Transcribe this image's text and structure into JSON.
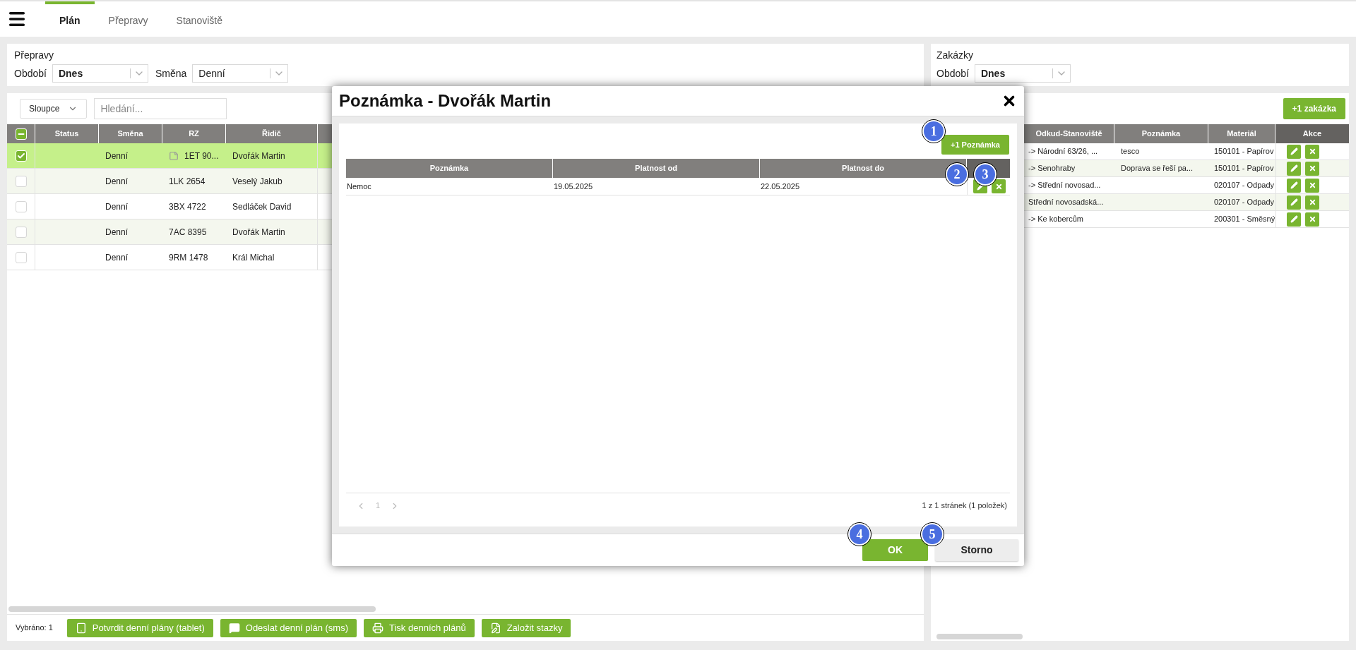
{
  "tabs": [
    {
      "label": "Plán",
      "selected": true
    },
    {
      "label": "Přepravy",
      "selected": false
    },
    {
      "label": "Stanoviště",
      "selected": false
    }
  ],
  "left_panel": {
    "title": "Přepravy",
    "filters": [
      {
        "label": "Období",
        "value": "Dnes",
        "emphasized": true
      },
      {
        "label": "Směna",
        "value": "Denní",
        "emphasized": false
      }
    ],
    "columns_button": "Sloupce",
    "search_placeholder": "Hledání...",
    "table": {
      "select_all_partial": true,
      "columns": [
        "Status",
        "Směna",
        "RZ",
        "Řidič"
      ],
      "rows": [
        {
          "selected": true,
          "has_note": true,
          "cells": [
            "",
            "Denní",
            "1ET 90...",
            "Dvořák Martin"
          ]
        },
        {
          "selected": false,
          "has_note": false,
          "cells": [
            "",
            "Denní",
            "1LK 2654",
            "Veselý Jakub"
          ]
        },
        {
          "selected": false,
          "has_note": false,
          "cells": [
            "",
            "Denní",
            "3BX 4722",
            "Sedláček David"
          ]
        },
        {
          "selected": false,
          "has_note": false,
          "cells": [
            "",
            "Denní",
            "7AC 8395",
            "Dvořák Martin"
          ]
        },
        {
          "selected": false,
          "has_note": false,
          "cells": [
            "",
            "Denní",
            "9RM 1478",
            "Král Michal"
          ]
        }
      ]
    },
    "selected_count": "Vybráno: 1",
    "actions": [
      {
        "label": "Potvrdit denní plány (tablet)",
        "kind": "tablet"
      },
      {
        "label": "Odeslat denní plán (sms)",
        "kind": "sms"
      },
      {
        "label": "Tisk denních plánů",
        "kind": "print"
      },
      {
        "label": "Založit stazky",
        "kind": "edit"
      }
    ]
  },
  "right_panel": {
    "title": "Zakázky",
    "filters": [
      {
        "label": "Období",
        "value": "Dnes",
        "emphasized": true
      }
    ],
    "add_button": "+1 zakázka",
    "table": {
      "columns": [
        {
          "label": "Odkud-Stanoviště",
          "kind": "data"
        },
        {
          "label": "Poznámka",
          "kind": "data"
        },
        {
          "label": "Materiál",
          "kind": "data"
        },
        {
          "label": "Akce",
          "kind": "actions"
        }
      ],
      "rows": [
        {
          "cells": [
            "-> Národní 63/26, ...",
            "tesco",
            "150101 - Papírov"
          ]
        },
        {
          "cells": [
            "-> Senohraby",
            "Doprava se řeší pa...",
            "150101 - Papírov"
          ]
        },
        {
          "cells": [
            "-> Střední novosad...",
            "",
            "020107 - Odpady"
          ]
        },
        {
          "cells": [
            "Střední novosadská...",
            "",
            "020107 - Odpady"
          ]
        },
        {
          "cells": [
            "-> Ke kobercům",
            "",
            "200301 - Směsný"
          ]
        }
      ]
    }
  },
  "modal": {
    "title": "Poznámka - Dvořák Martin",
    "add_button": "+1 Poznámka",
    "table": {
      "columns": [
        "Poznámka",
        "Platnost od",
        "Platnost do"
      ],
      "rows": [
        {
          "cells": [
            "Nemoc",
            "19.05.2025",
            "22.05.2025"
          ]
        }
      ]
    },
    "pagination": {
      "page": "1",
      "summary": "1 z 1 stránek (1 položek)"
    },
    "buttons": [
      {
        "label": "OK",
        "kind": "primary"
      },
      {
        "label": "Storno",
        "kind": "secondary"
      }
    ],
    "callouts": [
      "1",
      "2",
      "3",
      "4",
      "5"
    ]
  }
}
